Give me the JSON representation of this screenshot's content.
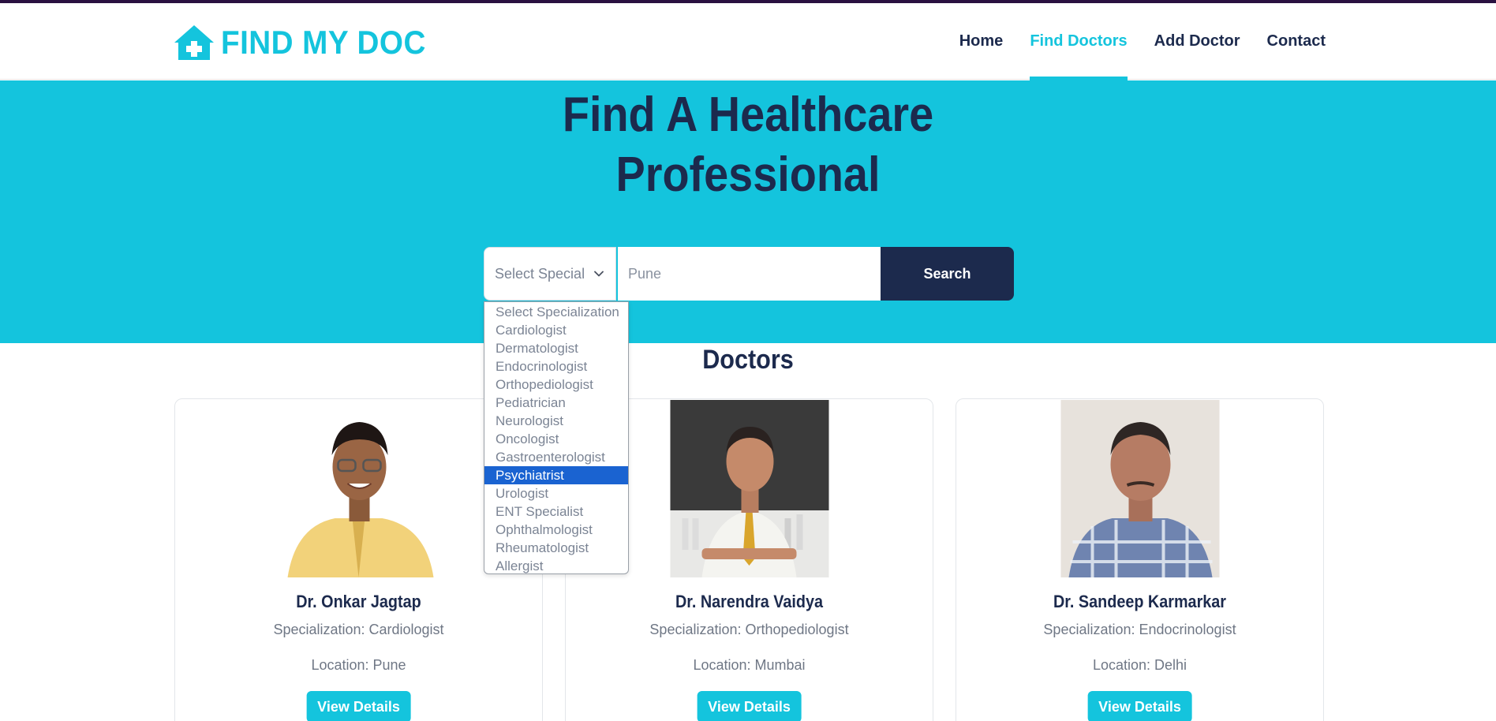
{
  "brand": {
    "name": "FIND MY DOC",
    "icon": "house-medical-icon",
    "color": "#14c4dd"
  },
  "nav": {
    "items": [
      {
        "label": "Home"
      },
      {
        "label": "Find Doctors"
      },
      {
        "label": "Add Doctor"
      },
      {
        "label": "Contact"
      }
    ],
    "active": "Find Doctors"
  },
  "hero": {
    "title_line1": "Find A Healthcare",
    "title_line2": "Professional",
    "background": "#14c4dd"
  },
  "search": {
    "specialization_selected": "Select Special",
    "location_placeholder": "Pune",
    "button_label": "Search",
    "options": [
      "Select Specialization",
      "Cardiologist",
      "Dermatologist",
      "Endocrinologist",
      "Orthopediologist",
      "Pediatrician",
      "Neurologist",
      "Oncologist",
      "Gastroenterologist",
      "Psychiatrist",
      "Urologist",
      "ENT Specialist",
      "Ophthalmologist",
      "Rheumatologist",
      "Allergist"
    ],
    "highlighted_option": "Psychiatrist"
  },
  "doctors": {
    "title": "Doctors",
    "items": [
      {
        "name": "Dr. Onkar Jagtap",
        "specialization": "Specialization: Cardiologist",
        "location": "Location: Pune",
        "button": "View Details"
      },
      {
        "name": "Dr. Narendra Vaidya",
        "specialization": "Specialization: Orthopediologist",
        "location": "Location: Mumbai",
        "button": "View Details"
      },
      {
        "name": "Dr. Sandeep Karmarkar",
        "specialization": "Specialization: Endocrinologist",
        "location": "Location: Delhi",
        "button": "View Details"
      }
    ]
  },
  "colors": {
    "navy": "#1c2a4d",
    "accent": "#14c4dd",
    "highlight": "#1a63d1"
  }
}
